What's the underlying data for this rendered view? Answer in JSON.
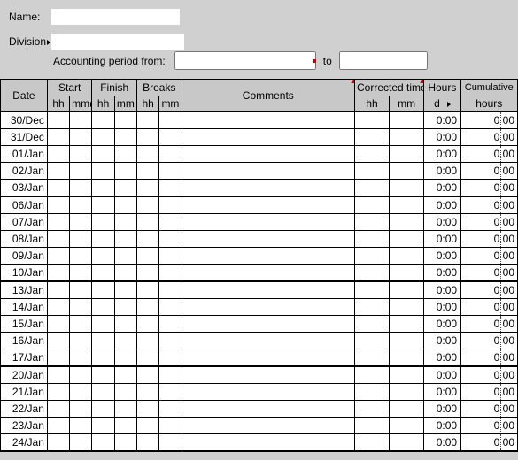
{
  "form": {
    "name_label": "Name:",
    "division_label": "Division",
    "period_label": "Accounting period from:",
    "to_label": "to",
    "name_value": "",
    "division_value": "",
    "from_value": "",
    "to_value": ""
  },
  "headers": {
    "date": "Date",
    "start": "Start",
    "finish": "Finish",
    "breaks": "Breaks",
    "comments": "Comments",
    "corrected": "Corrected time",
    "hours": "Hours",
    "cumulative": "Cumulative",
    "sub_hours": "hours",
    "hh": "hh",
    "mm": "mm",
    "d": "d"
  },
  "rows": [
    {
      "date": "30/Dec",
      "hours": "0:00",
      "cum": "0 00",
      "group_end": false
    },
    {
      "date": "31/Dec",
      "hours": "0:00",
      "cum": "0 00",
      "group_end": false
    },
    {
      "date": "01/Jan",
      "hours": "0:00",
      "cum": "0 00",
      "group_end": false
    },
    {
      "date": "02/Jan",
      "hours": "0:00",
      "cum": "0 00",
      "group_end": false
    },
    {
      "date": "03/Jan",
      "hours": "0:00",
      "cum": "0 00",
      "group_end": true
    },
    {
      "date": "06/Jan",
      "hours": "0:00",
      "cum": "0 00",
      "group_end": false
    },
    {
      "date": "07/Jan",
      "hours": "0:00",
      "cum": "0 00",
      "group_end": false
    },
    {
      "date": "08/Jan",
      "hours": "0:00",
      "cum": "0 00",
      "group_end": false
    },
    {
      "date": "09/Jan",
      "hours": "0:00",
      "cum": "0 00",
      "group_end": false
    },
    {
      "date": "10/Jan",
      "hours": "0:00",
      "cum": "0 00",
      "group_end": true
    },
    {
      "date": "13/Jan",
      "hours": "0:00",
      "cum": "0 00",
      "group_end": false
    },
    {
      "date": "14/Jan",
      "hours": "0:00",
      "cum": "0 00",
      "group_end": false
    },
    {
      "date": "15/Jan",
      "hours": "0:00",
      "cum": "0 00",
      "group_end": false
    },
    {
      "date": "16/Jan",
      "hours": "0:00",
      "cum": "0 00",
      "group_end": false
    },
    {
      "date": "17/Jan",
      "hours": "0:00",
      "cum": "0 00",
      "group_end": true
    },
    {
      "date": "20/Jan",
      "hours": "0:00",
      "cum": "0 00",
      "group_end": false
    },
    {
      "date": "21/Jan",
      "hours": "0:00",
      "cum": "0 00",
      "group_end": false
    },
    {
      "date": "22/Jan",
      "hours": "0:00",
      "cum": "0 00",
      "group_end": false
    },
    {
      "date": "23/Jan",
      "hours": "0:00",
      "cum": "0 00",
      "group_end": false
    },
    {
      "date": "24/Jan",
      "hours": "0:00",
      "cum": "0 00",
      "group_end": true
    }
  ]
}
